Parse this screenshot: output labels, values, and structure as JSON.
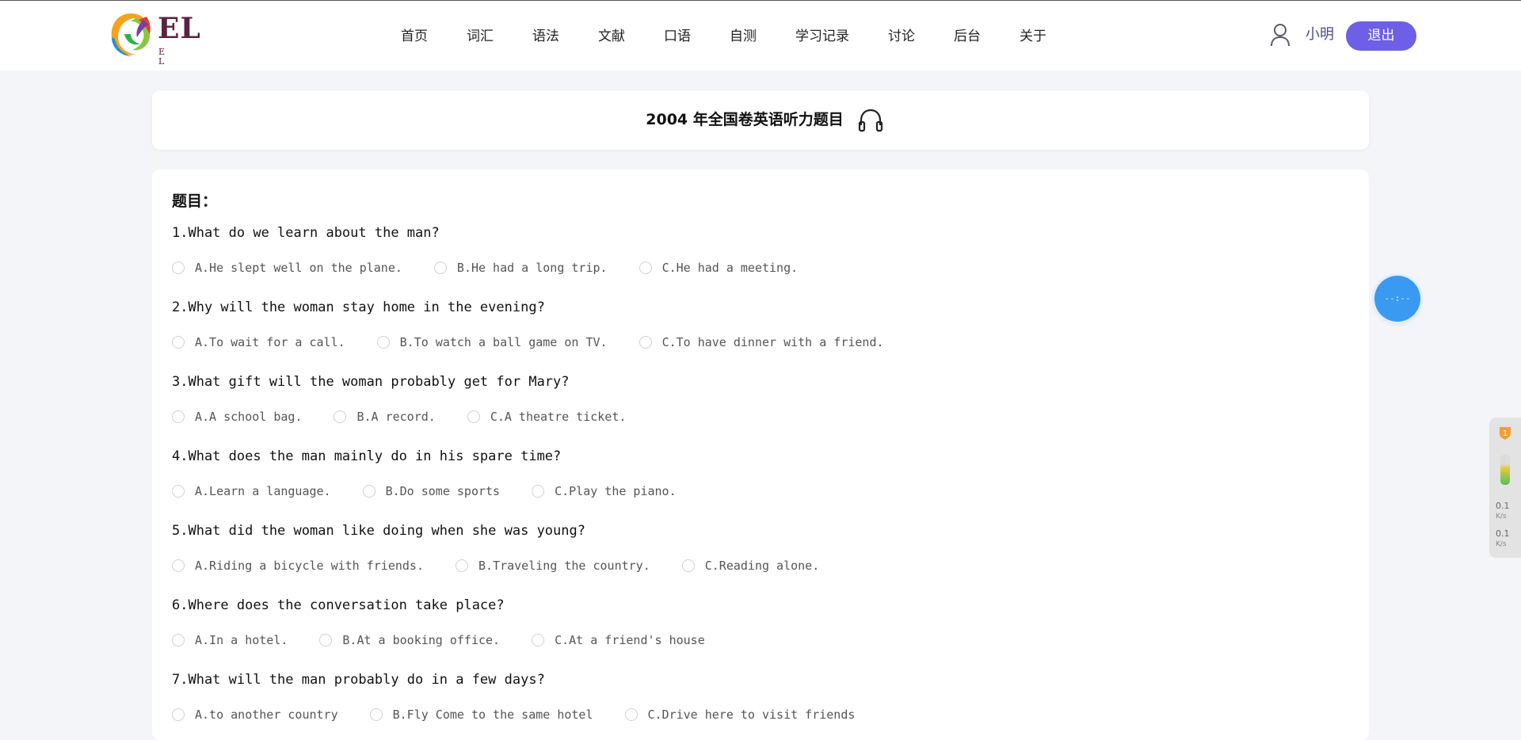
{
  "header": {
    "logo_text": "EL",
    "logo_sub": "E L",
    "nav": [
      "首页",
      "词汇",
      "语法",
      "文献",
      "口语",
      "自测",
      "学习记录",
      "讨论",
      "后台",
      "关于"
    ],
    "username": "小明",
    "logout_label": "退出"
  },
  "page": {
    "title": "2004 年全国卷英语听力题目",
    "section_label": "题目："
  },
  "questions": [
    {
      "text": "1.What do we learn about the man?",
      "options": [
        "A.He slept well on the plane.",
        "B.He had a long trip.",
        "C.He had a meeting."
      ]
    },
    {
      "text": "2.Why will the woman stay home in the evening?",
      "options": [
        "A.To wait for a call.",
        "B.To watch a ball game on TV.",
        "C.To have dinner with a friend."
      ]
    },
    {
      "text": "3.What gift will the woman probably get for Mary?",
      "options": [
        "A.A school bag.",
        "B.A record.",
        "C.A theatre ticket."
      ]
    },
    {
      "text": "4.What does the man mainly do in his spare time?",
      "options": [
        "A.Learn a language.",
        "B.Do some sports",
        "C.Play the piano."
      ]
    },
    {
      "text": "5.What did the woman like doing when she was young?",
      "options": [
        "A.Riding a bicycle with friends.",
        "B.Traveling the country.",
        "C.Reading alone."
      ]
    },
    {
      "text": "6.Where does the conversation take place?",
      "options": [
        "A.In a hotel.",
        "B.At a booking office.",
        "C.At a friend's house"
      ]
    },
    {
      "text": "7.What will the man probably do in a few days?",
      "options": [
        "A.to another country",
        "B.Fly Come to the same hotel",
        "C.Drive here to visit friends"
      ]
    }
  ],
  "timer": {
    "text": "--:--"
  },
  "widget": {
    "badge": "1",
    "upload_speed": "0.1",
    "upload_unit": "K/s",
    "download_speed": "0.1",
    "download_unit": "K/s"
  },
  "colors": {
    "accent": "#6d5fe6",
    "timer": "#3a9af2",
    "logo_text": "#5a2340"
  }
}
